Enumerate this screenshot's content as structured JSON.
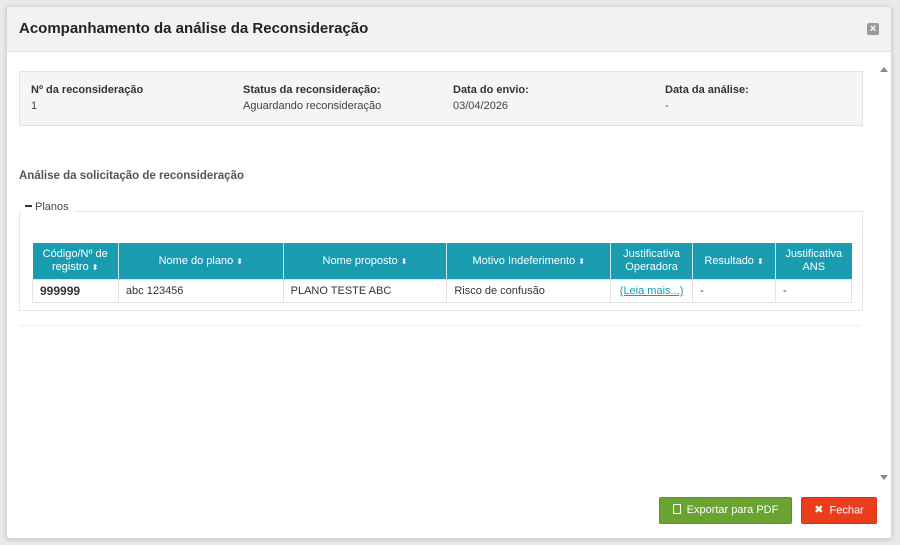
{
  "modal": {
    "title": "Acompanhamento da análise da Reconsideração",
    "close_icon": "×"
  },
  "info": {
    "numero_label": "Nº da reconsideração",
    "numero_value": "1",
    "status_label": "Status da reconsideração:",
    "status_value": "Aguardando reconsideração",
    "envio_label": "Data do envio:",
    "envio_value": "03/04/2026",
    "analise_label": "Data da análise:",
    "analise_value": "-"
  },
  "section": {
    "title": "Análise da solicitação de reconsideração",
    "legend": "Planos"
  },
  "table": {
    "sort_icon": "⬍",
    "headers": {
      "codigo_line1": "Código/Nº de",
      "codigo_line2": "registro",
      "nome_plano": "Nome do plano",
      "nome_proposto": "Nome proposto",
      "motivo": "Motivo Indeferimento",
      "justificativa_op_line1": "Justificativa",
      "justificativa_op_line2": "Operadora",
      "resultado": "Resultado",
      "justificativa_ans_line1": "Justificativa",
      "justificativa_ans_line2": "ANS"
    },
    "rows": [
      {
        "codigo": "999999",
        "nome_plano": "abc 123456",
        "nome_proposto": "PLANO TESTE ABC",
        "motivo": "Risco de confusão",
        "justificativa_op": "(Leia mais...)",
        "resultado": "-",
        "justificativa_ans": "-"
      }
    ]
  },
  "buttons": {
    "export_pdf": "Exportar para PDF",
    "fechar": "Fechar",
    "fechar_icon": "✖"
  },
  "colors": {
    "table_header": "#1a9bb0",
    "btn_pdf": "#6aa332",
    "btn_close": "#ea3d1c"
  }
}
